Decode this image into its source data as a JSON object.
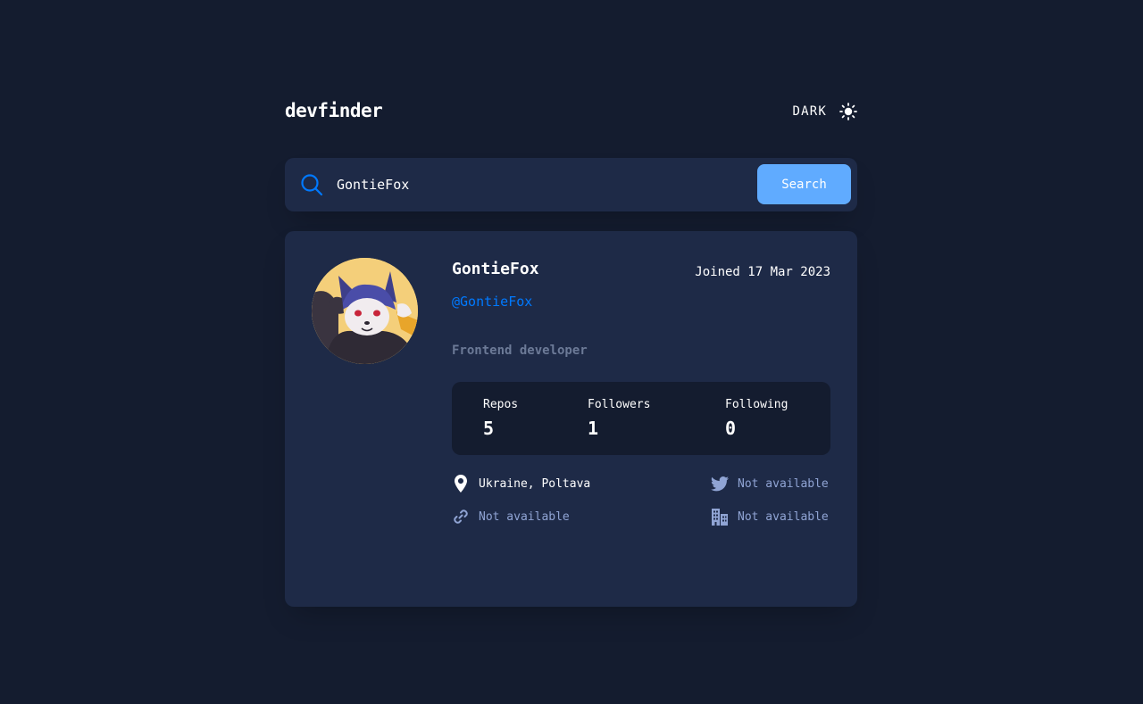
{
  "header": {
    "logo": "devfinder",
    "theme_label": "DARK",
    "theme_icon": "sun-icon"
  },
  "search": {
    "value": "GontieFox",
    "placeholder": "Search GitHub username…",
    "button_label": "Search",
    "icon": "search-icon"
  },
  "profile": {
    "name": "GontieFox",
    "joined": "Joined 17 Mar 2023",
    "login": "@GontieFox",
    "bio": "Frontend developer",
    "stats": {
      "repos_label": "Repos",
      "repos_value": "5",
      "followers_label": "Followers",
      "followers_value": "1",
      "following_label": "Following",
      "following_value": "0"
    },
    "links": {
      "location": "Ukraine, Poltava",
      "blog": "Not available",
      "twitter": "Not available",
      "company": "Not available"
    }
  },
  "colors": {
    "page_bg": "#141C2F",
    "card_bg": "#1E2A47",
    "accent": "#0079FF",
    "button_bg": "#60ABFF",
    "muted_text": "#6C7A97",
    "unavailable_text": "#90A4D4"
  }
}
